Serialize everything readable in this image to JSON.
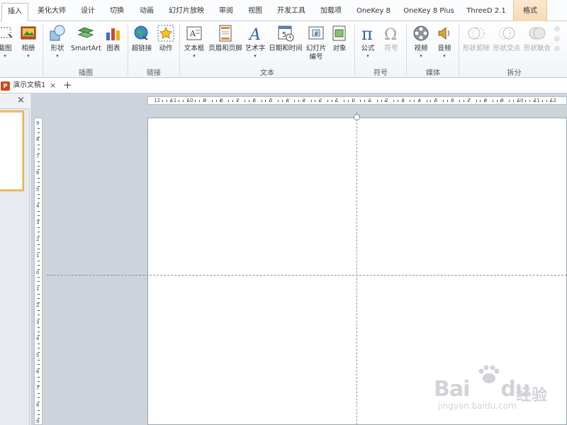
{
  "tabs": [
    "插入",
    "美化大师",
    "设计",
    "切换",
    "动画",
    "幻灯片放映",
    "审阅",
    "视图",
    "开发工具",
    "加载项",
    "OneKey 8",
    "OneKey 8 Plus",
    "ThreeD 2.1",
    "格式"
  ],
  "active_tab": "插入",
  "ribbon": {
    "buttons": {
      "screenshot": "截图",
      "album": "相册",
      "shape": "形状",
      "smartart": "SmartArt",
      "chart": "图表",
      "hyperlink": "超链接",
      "action": "动作",
      "textbox": "文本框",
      "header_footer": "页眉和页脚",
      "wordart": "艺术字",
      "datetime": "日期和时间",
      "slide_number_1": "幻灯片",
      "slide_number_2": "编号",
      "object": "对象",
      "equation": "公式",
      "symbol": "符号",
      "video": "视频",
      "audio": "音频",
      "shape_crop": "形状剪除",
      "shape_intersect": "形状交点",
      "shape_union": "形状联合"
    },
    "groups": {
      "illustrations": "插图",
      "links": "链接",
      "text": "文本",
      "symbols": "符号",
      "media": "媒体",
      "split": "拆分"
    }
  },
  "document": {
    "tab_title": "演示文稿1",
    "app_badge": "P",
    "close_tab": "×",
    "new_tab": "+"
  },
  "left_panel": {
    "close": "×"
  },
  "ruler": {
    "horizontal": [
      "12",
      "11",
      "10",
      "9",
      "8",
      "7",
      "6",
      "5",
      "4",
      "3",
      "2",
      "1",
      "0",
      "1",
      "2",
      "3",
      "4",
      "5",
      "6",
      "7",
      "8",
      "9",
      "10",
      "11",
      "12"
    ],
    "vertical": [
      "9",
      "8",
      "7",
      "6",
      "5",
      "4",
      "3",
      "2",
      "1",
      "0",
      "1",
      "2",
      "3",
      "4",
      "5",
      "6",
      "7",
      "8",
      "9"
    ]
  },
  "watermark": {
    "brand": "Bai",
    "brand2": "du",
    "cn": "经验",
    "url": "jingyan.baidu.com"
  },
  "colors": {
    "accent_tab": "#f8d9b3",
    "ppt_orange": "#d04a1f",
    "selection": "#f0c575"
  }
}
